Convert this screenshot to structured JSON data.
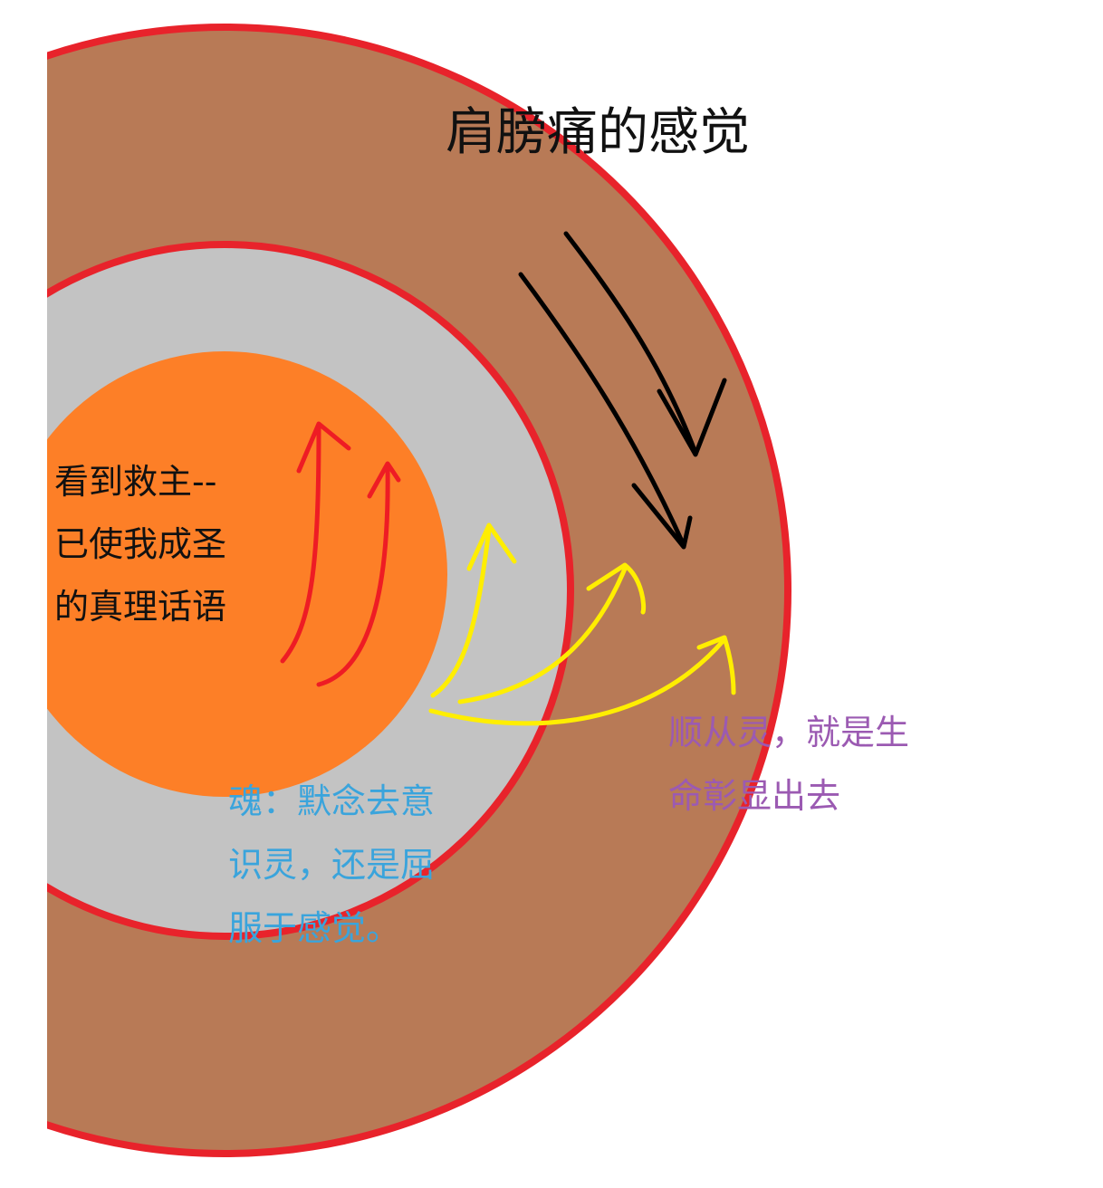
{
  "diagram": {
    "outer_ring_label": "肩膀痛的感觉",
    "core_label_lines": [
      "看到救主--",
      "已使我成圣",
      "的真理话语"
    ],
    "soul_label_lines": [
      "魂：默念去意",
      "识灵，还是屈",
      "服于感觉。"
    ],
    "spirit_label_lines": [
      "顺从灵，就是生",
      "命彰显出去"
    ]
  },
  "colors": {
    "outer_ring": "#b87a56",
    "ring_border": "#e8232b",
    "middle_ring": "#c3c3c3",
    "core": "#fd7f27",
    "core_arrows": "#ee1c24",
    "outgoing_arrows": "#ffee00",
    "incoming_arrows": "#000000",
    "outer_text": "#111111",
    "core_text": "#111111",
    "soul_text": "#3aa4dc",
    "spirit_text": "#9b5ab2"
  }
}
